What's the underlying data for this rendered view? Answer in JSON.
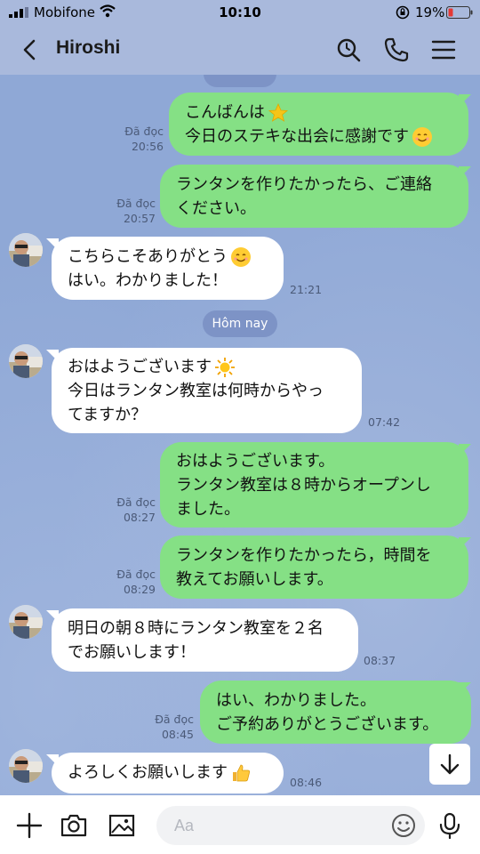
{
  "status_bar": {
    "carrier": "Mobifone",
    "time": "10:10",
    "battery": "19%"
  },
  "header": {
    "title": "Hiroshi"
  },
  "date_separators": {
    "today": "Hôm nay"
  },
  "messages": [
    {
      "dir": "out",
      "lines": [
        "こんばんは",
        "今日のステキな出会に感謝です"
      ],
      "read": "Đã đọc",
      "time": "20:56"
    },
    {
      "dir": "out",
      "lines": [
        "ランタンを作りたかったら、ご連絡",
        "ください。"
      ],
      "read": "Đã đọc",
      "time": "20:57"
    },
    {
      "dir": "in",
      "lines": [
        "こちらこそありがとう",
        "はい。わかりました！"
      ],
      "time": "21:21"
    },
    {
      "dir": "in",
      "lines": [
        "おはようございます",
        "今日はランタン教室は何時からやっ",
        "てますか？"
      ],
      "time": "07:42"
    },
    {
      "dir": "out",
      "lines": [
        "おはようございます。",
        "ランタン教室は８時からオープンし",
        "ました。"
      ],
      "read": "Đã đọc",
      "time": "08:27"
    },
    {
      "dir": "out",
      "lines": [
        "ランタンを作りたかったら，時間を",
        "教えてお願いします。"
      ],
      "read": "Đã đọc",
      "time": "08:29"
    },
    {
      "dir": "in",
      "lines": [
        "明日の朝８時にランタン教室を２名",
        "でお願いします！"
      ],
      "time": "08:37"
    },
    {
      "dir": "out",
      "lines": [
        "はい、わかりました。",
        "ご予約ありがとうございます。"
      ],
      "read": "Đã đọc",
      "time": "08:45"
    },
    {
      "dir": "in",
      "lines": [
        "よろしくお願いします"
      ],
      "time": "08:46"
    }
  ],
  "input": {
    "placeholder": "Aa"
  },
  "icons": {
    "status": [
      "signal-icon",
      "wifi-icon",
      "rotation-lock-icon",
      "battery-icon"
    ],
    "header": [
      "back-icon",
      "search-icon",
      "phone-icon",
      "menu-icon"
    ],
    "input_bar": [
      "plus-icon",
      "camera-icon",
      "image-icon",
      "emoji-icon",
      "microphone-icon"
    ],
    "emojis": [
      "star-emoji",
      "smile-emoji",
      "sun-emoji",
      "thumbs-up-emoji"
    ]
  },
  "colors": {
    "header_bg": "#a9b9dc",
    "chat_bg": "#8fa8d6",
    "outgoing_bubble": "#85e085",
    "incoming_bubble": "#ffffff",
    "battery_low": "#e53935"
  }
}
